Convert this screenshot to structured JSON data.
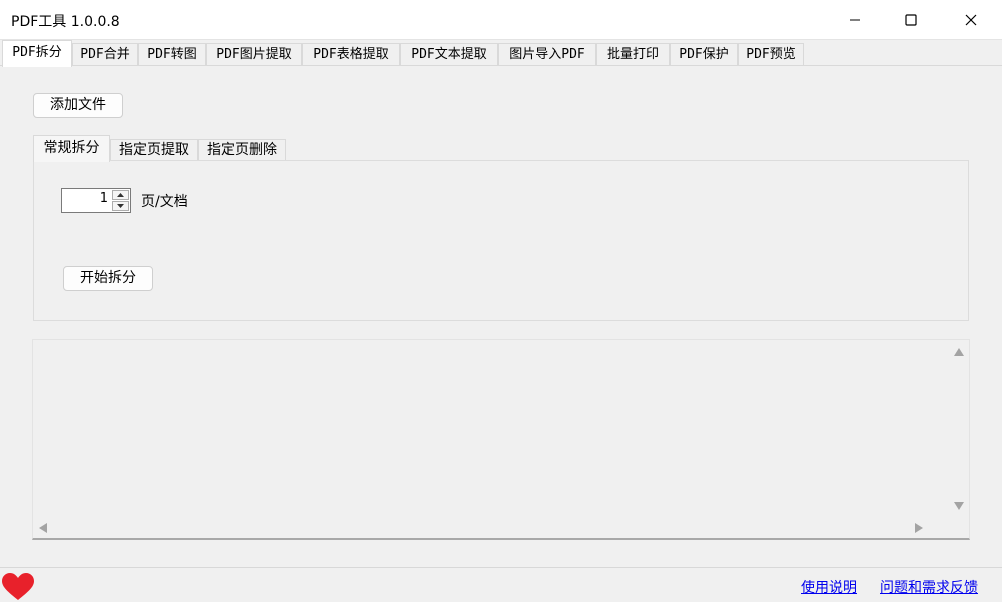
{
  "window": {
    "title": "PDF工具 1.0.0.8"
  },
  "main_tabs": [
    {
      "label": "PDF拆分"
    },
    {
      "label": "PDF合并"
    },
    {
      "label": "PDF转图"
    },
    {
      "label": "PDF图片提取"
    },
    {
      "label": "PDF表格提取"
    },
    {
      "label": "PDF文本提取"
    },
    {
      "label": "图片导入PDF"
    },
    {
      "label": "批量打印"
    },
    {
      "label": "PDF保护"
    },
    {
      "label": "PDF预览"
    }
  ],
  "toolbar": {
    "add_file_label": "添加文件"
  },
  "sub_tabs": [
    {
      "label": "常规拆分"
    },
    {
      "label": "指定页提取"
    },
    {
      "label": "指定页删除"
    }
  ],
  "split": {
    "pages_value": "1",
    "pages_unit": "页/文档",
    "start_label": "开始拆分"
  },
  "footer": {
    "help_link": "使用说明",
    "feedback_link": "问题和需求反馈"
  },
  "colors": {
    "heart": "#e8212b",
    "link": "#0000ee",
    "background": "#f0f0f0"
  }
}
